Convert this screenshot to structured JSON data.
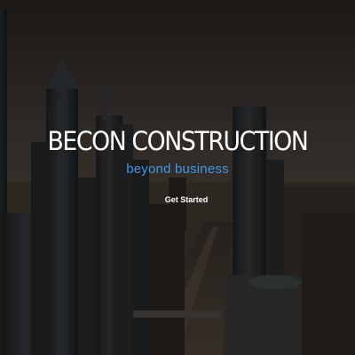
{
  "hero": {
    "title": "BECON CONSTRUCTION",
    "tagline": "beyond business",
    "cta_label": "Get Started"
  },
  "colors": {
    "tagline": "#3f97e6",
    "title": "#ffffff",
    "overlay": "#0a0806"
  },
  "background": {
    "image": "city-skyline-background"
  }
}
